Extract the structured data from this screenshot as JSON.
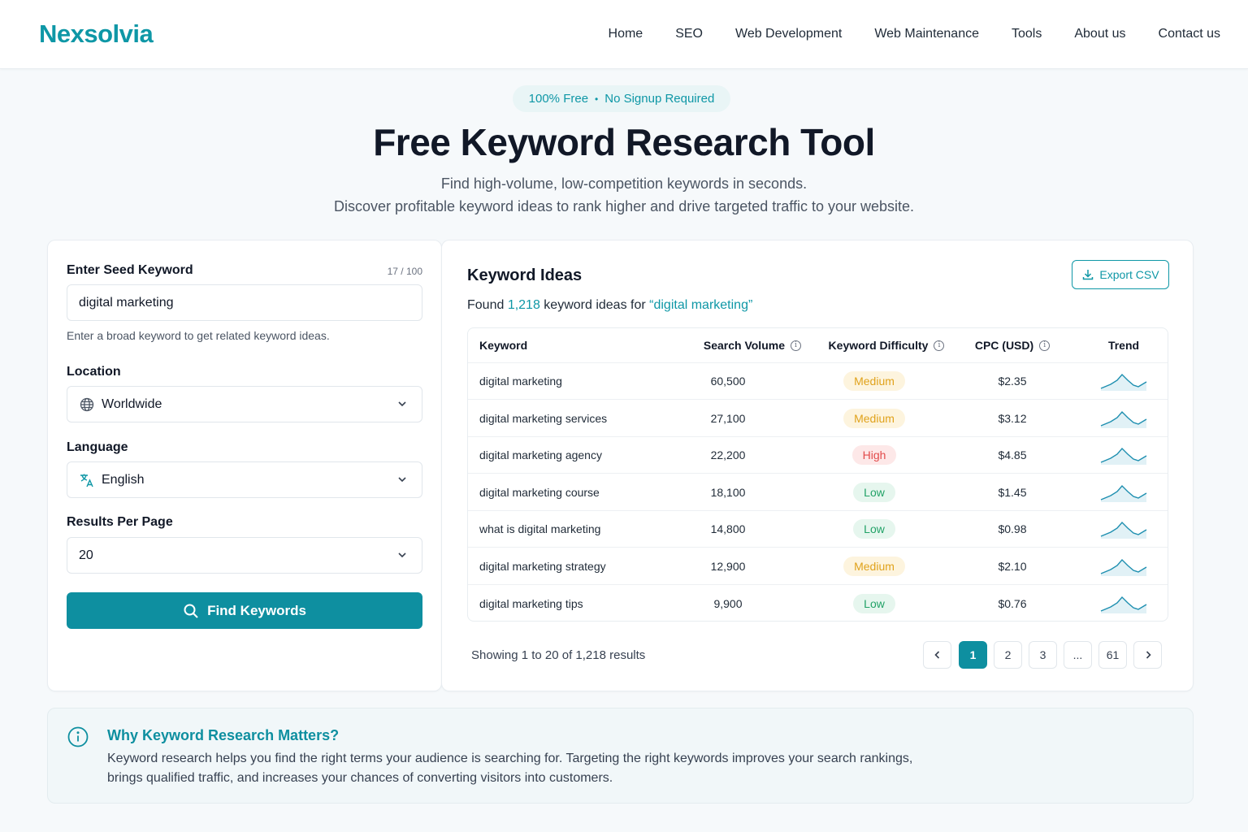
{
  "brand": {
    "logo": "Nexsolvia",
    "accent": "#0e97a6"
  },
  "nav": [
    "Home",
    "SEO",
    "Web Development",
    "Web Maintenance",
    "Tools",
    "About us",
    "Contact us"
  ],
  "hero": {
    "pill_left": "100% Free",
    "pill_sep": "•",
    "pill_right": "No Signup Required",
    "title": "Free Keyword Research Tool",
    "subtitle1": "Find high-volume, low-competition keywords in seconds.",
    "subtitle2": "Discover profitable keyword ideas to rank higher and drive targeted traffic to your website."
  },
  "form": {
    "seed_label": "Enter Seed Keyword",
    "seed_counter": "17 / 100",
    "seed_value": "digital marketing",
    "seed_help": "Enter a broad keyword to get related keyword ideas.",
    "location_label": "Location",
    "location_value": "Worldwide",
    "language_label": "Language",
    "language_value": "English",
    "results_label": "Results Per Page",
    "results_value": "20",
    "find_button": "Find Keywords"
  },
  "results": {
    "title": "Keyword Ideas",
    "found_prefix": "Found ",
    "found_count": "1,218",
    "found_mid": " keyword ideas for ",
    "found_query": "“digital marketing”",
    "export_label": "Export CSV",
    "columns": {
      "keyword": "Keyword",
      "volume": "Search Volume",
      "difficulty": "Keyword Difficulty",
      "cpc": "CPC (USD)",
      "trend": "Trend"
    },
    "rows": [
      {
        "keyword": "digital marketing",
        "volume": "60,500",
        "difficulty": "Medium",
        "level": "medium",
        "cpc": "$2.35"
      },
      {
        "keyword": "digital marketing services",
        "volume": "27,100",
        "difficulty": "Medium",
        "level": "medium",
        "cpc": "$3.12"
      },
      {
        "keyword": "digital marketing agency",
        "volume": "22,200",
        "difficulty": "High",
        "level": "high",
        "cpc": "$4.85"
      },
      {
        "keyword": "digital marketing course",
        "volume": "18,100",
        "difficulty": "Low",
        "level": "low",
        "cpc": "$1.45"
      },
      {
        "keyword": "what is digital marketing",
        "volume": "14,800",
        "difficulty": "Low",
        "level": "low",
        "cpc": "$0.98"
      },
      {
        "keyword": "digital marketing strategy",
        "volume": "12,900",
        "difficulty": "Medium",
        "level": "medium",
        "cpc": "$2.10"
      },
      {
        "keyword": "digital marketing tips",
        "volume": "9,900",
        "difficulty": "Low",
        "level": "low",
        "cpc": "$0.76"
      }
    ],
    "showing": "Showing 1 to 20 of 1,218 results",
    "pages": [
      "1",
      "2",
      "3",
      "...",
      "61"
    ],
    "current_page": "1"
  },
  "info": {
    "title": "Why Keyword Research Matters?",
    "body": "Keyword research helps you find the right terms your audience is searching for. Targeting the right keywords improves your search rankings, brings qualified traffic, and increases your chances of converting visitors into customers."
  }
}
